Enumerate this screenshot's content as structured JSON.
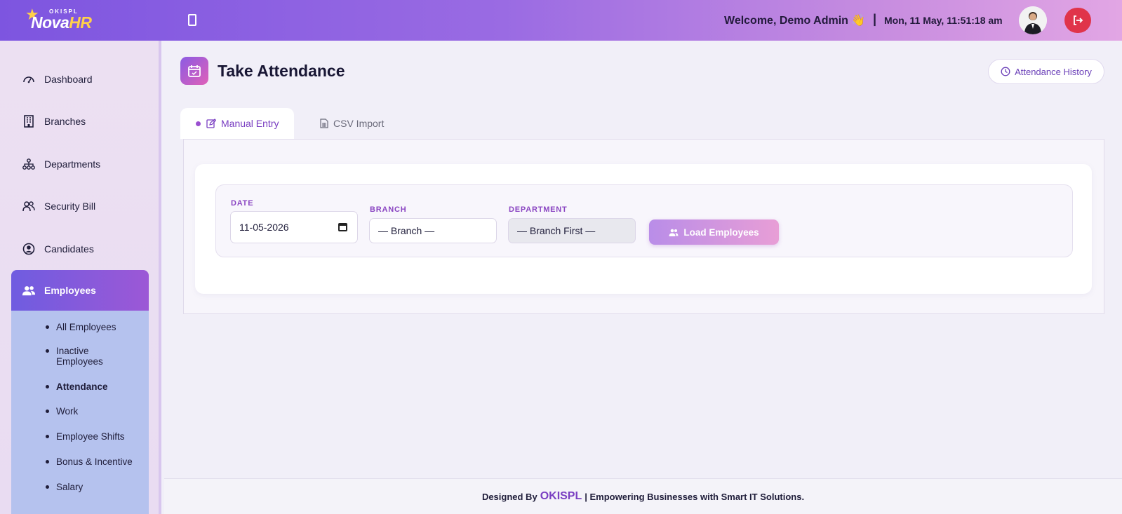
{
  "header": {
    "logo_small": "OKISPL",
    "logo_nova": "Nova",
    "logo_hr": "HR",
    "welcome": "Welcome, Demo Admin 👋",
    "separator": "|",
    "datetime": "Mon, 11 May, 11:51:18 am"
  },
  "sidebar": {
    "items": [
      {
        "label": "Dashboard",
        "icon": "dashboard-icon"
      },
      {
        "label": "Branches",
        "icon": "building-icon"
      },
      {
        "label": "Departments",
        "icon": "sitemap-icon"
      },
      {
        "label": "Security Bill",
        "icon": "users-icon"
      },
      {
        "label": "Candidates",
        "icon": "user-circle-icon"
      },
      {
        "label": "Employees",
        "icon": "users-icon"
      }
    ],
    "submenu": [
      {
        "label": "All Employees"
      },
      {
        "label": "Inactive Employees"
      },
      {
        "label": "Attendance"
      },
      {
        "label": "Work"
      },
      {
        "label": "Employee Shifts"
      },
      {
        "label": "Bonus & Incentive"
      },
      {
        "label": "Salary"
      }
    ]
  },
  "page": {
    "title": "Take Attendance",
    "history_button": "Attendance History"
  },
  "tabs": [
    {
      "label": "Manual Entry"
    },
    {
      "label": "CSV Import"
    }
  ],
  "filters": {
    "date_label": "DATE",
    "date_value": "11-05-2026",
    "branch_label": "BRANCH",
    "branch_value": "— Branch —",
    "department_label": "DEPARTMENT",
    "department_value": "— Branch First —",
    "load_button": "Load Employees"
  },
  "footer": {
    "prefix": "Designed By",
    "brand": "OKISPL",
    "suffix": "| Empowering Businesses with Smart IT Solutions."
  },
  "colors": {
    "accent": "#7a3fc2",
    "logout": "#e0344a",
    "active_nav": "#6f5ce0",
    "submenu_bg": "#b5c2ee"
  }
}
